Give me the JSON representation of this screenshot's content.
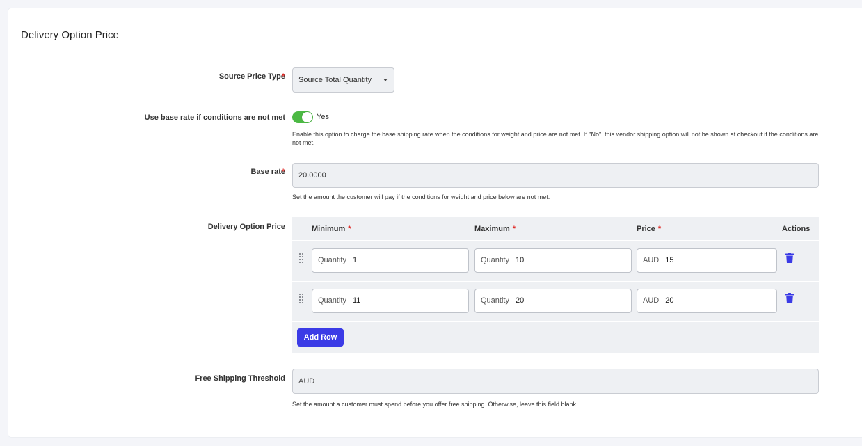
{
  "section": {
    "title": "Delivery Option Price"
  },
  "source_price_type": {
    "label": "Source Price Type",
    "required_mark": "*",
    "value": "Source Total Quantity",
    "caret_icon": "caret-down-icon"
  },
  "base_rate_toggle": {
    "label": "Use base rate if conditions are not met",
    "state": true,
    "state_text": "Yes",
    "toggle_color": "#4cb944",
    "note": "Enable this option to charge the base shipping rate when the conditions for weight and price are not met. If \"No\", this vendor shipping option will not be shown at checkout if the conditions are not met."
  },
  "base_rate": {
    "label": "Base rate",
    "required_mark": "*",
    "value": "20.0000",
    "note": "Set the amount the customer will pay if the conditions for weight and price below are not met."
  },
  "delivery_price": {
    "label": "Delivery Option Price",
    "columns": {
      "minimum": "Minimum",
      "maximum": "Maximum",
      "price": "Price",
      "actions": "Actions",
      "required_mark": "*"
    },
    "rows": [
      {
        "min_addon": "Quantity",
        "min": "1",
        "max_addon": "Quantity",
        "max": "10",
        "price_addon": "AUD",
        "price": "15"
      },
      {
        "min_addon": "Quantity",
        "min": "11",
        "max_addon": "Quantity",
        "max": "20",
        "price_addon": "AUD",
        "price": "20"
      }
    ],
    "add_row_label": "Add Row",
    "accent_color": "#3b3be6"
  },
  "free_shipping": {
    "label": "Free Shipping Threshold",
    "addon": "AUD",
    "value": "",
    "note": "Set the amount a customer must spend before you offer free shipping. Otherwise, leave this field blank."
  }
}
